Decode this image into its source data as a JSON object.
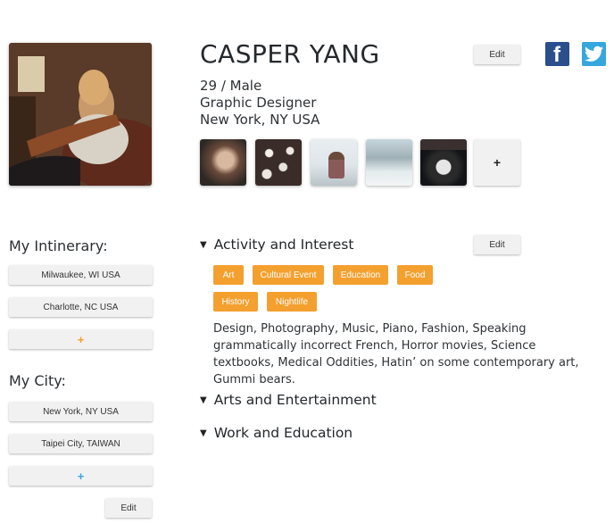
{
  "profile": {
    "name": "CASPER YANG",
    "age_gender": "29 / Male",
    "occupation": "Graphic Designer",
    "location": "New York, NY USA",
    "edit_label": "Edit"
  },
  "social": {
    "facebook_icon": "facebook-icon",
    "twitter_icon": "twitter-icon",
    "facebook_color": "#2b4f8c",
    "twitter_color": "#36a7de"
  },
  "photos": {
    "count": 5,
    "add_label": "+"
  },
  "itinerary": {
    "title": "My Intinerary:",
    "items": [
      "Milwaukee, WI USA",
      "Charlotte, NC USA"
    ],
    "add_label": "+"
  },
  "city": {
    "title": "My City:",
    "items": [
      "New York, NY USA",
      "Taipei City,  TAIWAN"
    ],
    "add_label": "+",
    "edit_label": "Edit"
  },
  "activity": {
    "title": "Activity and Interest",
    "edit_label": "Edit",
    "tags": [
      "Art",
      "Cultural Event",
      "Education",
      "Food",
      "History",
      "Nightlife"
    ],
    "description": "Design, Photography, Music, Piano, Fashion, Speaking grammatically incorrect French, Horror movies, Science textbooks, Medical Oddities, Hatin’ on some contemporary art, Gummi bears."
  },
  "sections": {
    "arts": "Arts and Entertainment",
    "work": "Work and Education"
  },
  "colors": {
    "tag_orange": "#f4a02f",
    "accent_blue": "#36a7de"
  }
}
